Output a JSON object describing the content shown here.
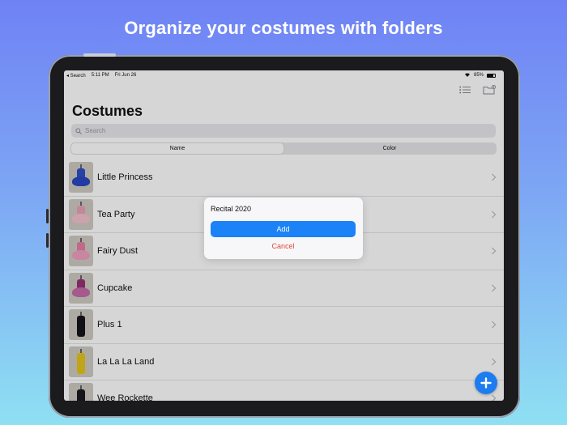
{
  "headline": "Organize your costumes with folders",
  "statusbar": {
    "back_label": "◂ Search",
    "time": "5:11 PM",
    "date": "Fri Jun 26",
    "battery_pct": "85%"
  },
  "page": {
    "title": "Costumes"
  },
  "search": {
    "placeholder": "Search"
  },
  "sort": {
    "options": [
      {
        "label": "Name",
        "selected": true
      },
      {
        "label": "Color",
        "selected": false
      }
    ]
  },
  "costumes": [
    {
      "name": "Little Princess",
      "colors": [
        "#2f4fc8",
        "#2946c0"
      ]
    },
    {
      "name": "Tea Party",
      "colors": [
        "#e9a3b6",
        "#f3c2cf"
      ]
    },
    {
      "name": "Fairy Dust",
      "colors": [
        "#e27fa6",
        "#f0a0c0"
      ]
    },
    {
      "name": "Cupcake",
      "colors": [
        "#9a2f76",
        "#c66aa7"
      ]
    },
    {
      "name": "Plus 1",
      "colors": [
        "#15151a",
        "#15151a"
      ]
    },
    {
      "name": "La La La Land",
      "colors": [
        "#e4c51c",
        "#e4c51c"
      ]
    },
    {
      "name": "Wee Rockette",
      "colors": [
        "#1a1a20",
        "#3a3a44"
      ]
    }
  ],
  "dialog": {
    "field_value": "Recital 2020",
    "add_label": "Add",
    "cancel_label": "Cancel"
  },
  "colors": {
    "accent": "#1b82f7",
    "destructive": "#e24a39",
    "fab": "#1c7cf0"
  }
}
